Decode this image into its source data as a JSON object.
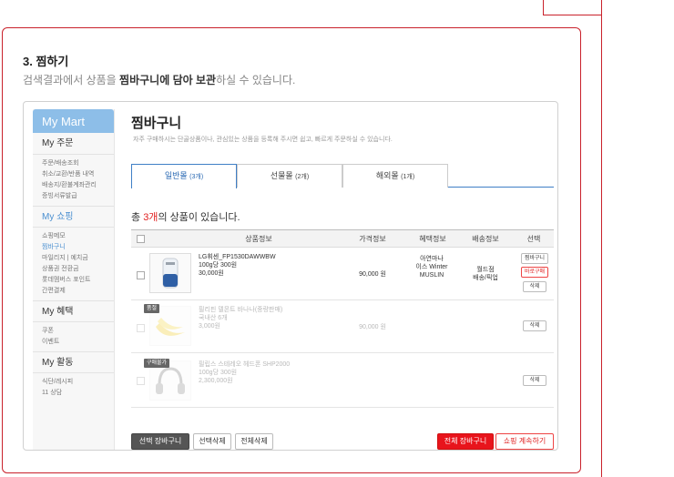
{
  "section": {
    "title": "3. 찜하기",
    "desc_pre": "검색결과에서 상품을 ",
    "desc_bold": "찜바구니에 담아 보관",
    "desc_post": "하실 수 있습니다."
  },
  "sidebar": {
    "header": "My Mart",
    "sections": [
      {
        "title": "My 주문",
        "items": [
          "주문/배송조회",
          "취소/교환/반품 내역",
          "배송지/환불계좌관리",
          "증빙서류발급"
        ]
      },
      {
        "title": "My 쇼핑",
        "items": [
          "쇼핑메모",
          "찜바구니",
          "마일리지 | 예치금",
          "상품권 전환금",
          "롯데멤버스 포인트",
          "간편결제"
        ]
      },
      {
        "title": "My 혜택",
        "items": [
          "쿠폰",
          "이벤트"
        ]
      },
      {
        "title": "My 활동",
        "items": [
          "식단/레시피",
          "11 상담"
        ]
      }
    ]
  },
  "main": {
    "title": "찜바구니",
    "desc": "자주 구매하시는 단골상품이나, 관심있는 상품을 등록해 주시면 쉽고, 빠르게 주문하실 수 있습니다."
  },
  "tabs": [
    {
      "label": "일반몰",
      "count": "(3개)"
    },
    {
      "label": "선물몰",
      "count": "(2개)"
    },
    {
      "label": "해외몰",
      "count": "(1개)"
    }
  ],
  "total": {
    "pre": "총 ",
    "count": "3개",
    "post": "의 상품이 있습니다."
  },
  "table": {
    "headers": [
      "상품정보",
      "가격정보",
      "혜택정보",
      "배송정보",
      "선택"
    ]
  },
  "rows": [
    {
      "name": "LG휘센_FP1530DAWWBW",
      "line2": "100g당 300원",
      "line3": "30,000원",
      "price": "90,000 원",
      "benefit": [
        "아연마나",
        "이스 Winter",
        "MUSLIN"
      ],
      "ship": [
        "월드점",
        "배송/픽업"
      ],
      "buttons": [
        "찜바구니",
        "바로구매",
        "삭제"
      ]
    },
    {
      "tag": "품절",
      "name": "필리핀 델몬트 바나나(중량판매)",
      "line2": "국내산 6개",
      "line3": "3,000원",
      "price": "90,000 원",
      "buttons": [
        "삭제"
      ]
    },
    {
      "tag": "구매불가",
      "name": "필립스 스테레오 헤드폰 SHP2000",
      "line2": "100g당 300원",
      "line3": "2,300,000원",
      "buttons": [
        "삭제"
      ]
    }
  ],
  "bottom": {
    "select_cart": "선택 장바구니",
    "select_delete": "선택삭제",
    "delete_all": "전체삭제",
    "all_cart": "전체 장바구니",
    "continue": "쇼핑 계속하기"
  },
  "colors": {
    "accent_red": "#c9212b",
    "sidebar_blue": "#8dbee8",
    "tab_blue": "#3f7fc6",
    "cart_red": "#e8141c"
  }
}
